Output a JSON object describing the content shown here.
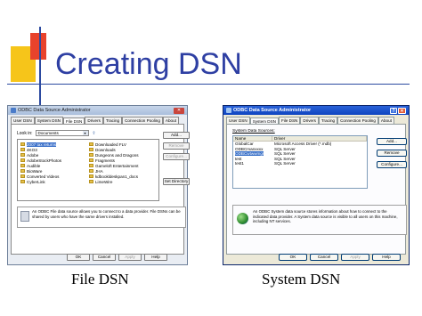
{
  "slide": {
    "title": "Creating DSN",
    "caption_left": "File DSN",
    "caption_right": "System DSN"
  },
  "colors": {
    "title": "#2e3fa3",
    "deco_yellow": "#f6c51a",
    "deco_red": "#e8432c",
    "xp_titlebar": "#0f44c0",
    "selection": "#316ac5"
  },
  "file_dsn_dialog": {
    "title": "ODBC Data Source Administrator",
    "tabs": [
      "User DSN",
      "System DSN",
      "File DSN",
      "Drivers",
      "Tracing",
      "Connection Pooling",
      "About"
    ],
    "active_tab": "File DSN",
    "look_in_label": "Look in:",
    "look_in_value": "Documents",
    "files_col1": [
      "2007 tax returns",
      "4KO3",
      "Adobe",
      "AdobeStockPhotos",
      "Audible",
      "BioWare",
      "Converted Videos",
      "CyberLink"
    ],
    "files_col2": [
      "Downloaded FLV",
      "Downloads",
      "Dungeons and Dragons",
      "Fragments",
      "Gameloft Entertainment",
      "JHA",
      "kdbookldeskpan1_docs",
      "LimeWire"
    ],
    "buttons": {
      "add": "Add...",
      "remove": "Remove",
      "configure": "Configure...",
      "set_directory": "Set Directory",
      "ok": "OK",
      "cancel": "Cancel",
      "apply": "Apply",
      "help": "Help"
    },
    "info_text": "An ODBC File data source allows you to connect to a data provider. File DSNs can be shared by users who have the same drivers installed."
  },
  "system_dsn_dialog": {
    "title": "ODBC Data Source Administrator",
    "tabs": [
      "User DSN",
      "System DSN",
      "File DSN",
      "Drivers",
      "Tracing",
      "Connection Pooling",
      "About"
    ],
    "active_tab": "System DSN",
    "group_label": "System Data Sources:",
    "columns": [
      "Name",
      "Driver"
    ],
    "rows": [
      {
        "name": "GlobalCar",
        "driver": "Microsoft Access Driver (*.mdb)"
      },
      {
        "name": "ODBCmanxxxx",
        "driver": "SQL Server"
      },
      {
        "name": "ODBCwtwwmgr",
        "driver": "SQL Server"
      },
      {
        "name": "test",
        "driver": "SQL Server"
      },
      {
        "name": "test1",
        "driver": "SQL Server"
      }
    ],
    "selected_row": 2,
    "buttons": {
      "add": "Add...",
      "remove": "Remove",
      "configure": "Configure...",
      "ok": "OK",
      "cancel": "Cancel",
      "apply": "Apply",
      "help": "Help"
    },
    "info_text": "An ODBC System data source stores information about how to connect to the indicated data provider. A System data source is visible to all users on this machine, including NT services."
  }
}
